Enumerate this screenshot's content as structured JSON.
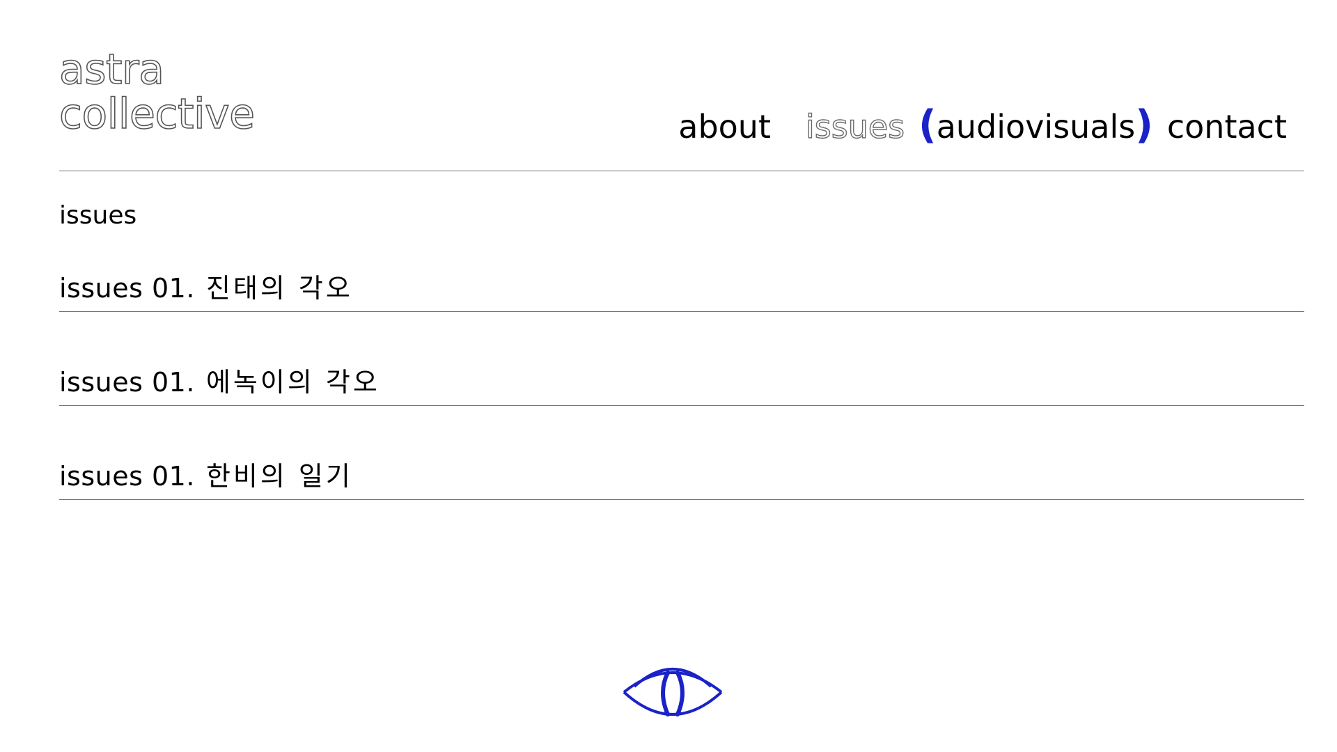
{
  "logo": {
    "line1": "astra",
    "line2": "collective"
  },
  "nav": {
    "about": "about",
    "issues": "issues",
    "paren_open": "(",
    "audiovisuals": "audiovisuals",
    "paren_close": ")",
    "contact": "contact"
  },
  "section_title": "issues",
  "issues": [
    {
      "prefix": "issues 01.",
      "title": "진태의 각오"
    },
    {
      "prefix": "issues 01.",
      "title": "에녹이의 각오"
    },
    {
      "prefix": "issues 01.",
      "title": "한비의 일기"
    }
  ],
  "colors": {
    "accent": "#1a22c8",
    "divider": "#707070",
    "outline": "#555555"
  },
  "icons": {
    "footer": "eye-icon"
  }
}
